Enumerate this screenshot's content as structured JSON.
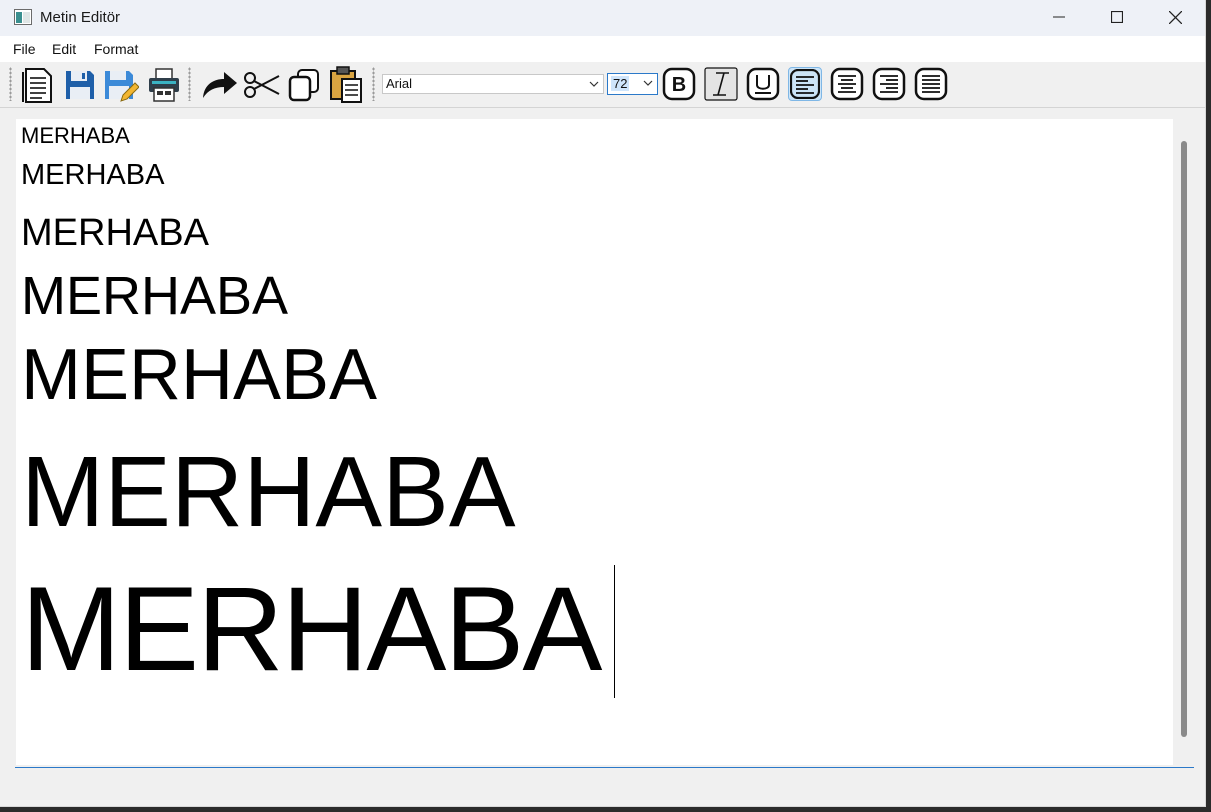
{
  "window": {
    "title": "Metin Editör"
  },
  "menu": {
    "file": "File",
    "edit": "Edit",
    "format": "Format"
  },
  "toolbar": {
    "new_icon": "new-document-icon",
    "save_icon": "save-icon",
    "save_as_icon": "save-as-icon",
    "print_icon": "print-icon",
    "redo_icon": "redo-icon",
    "cut_icon": "cut-icon",
    "copy_icon": "copy-icon",
    "paste_icon": "paste-icon",
    "font_family": "Arial",
    "font_size": "72",
    "bold_icon": "bold-icon",
    "italic_icon": "italic-icon",
    "underline_icon": "underline-icon",
    "align_left_icon": "align-left-icon",
    "align_center_icon": "align-center-icon",
    "align_right_icon": "align-right-icon",
    "justify_icon": "justify-icon",
    "active_alignment": "left"
  },
  "editor": {
    "lines": [
      "MERHABA",
      "MERHABA",
      "MERHABA",
      "MERHABA",
      "MERHABA",
      "MERHABA",
      "MERHABA"
    ]
  },
  "colors": {
    "accent": "#2b79c9",
    "selected_button": "#cce4f7",
    "titlebar": "#eef1f7"
  }
}
